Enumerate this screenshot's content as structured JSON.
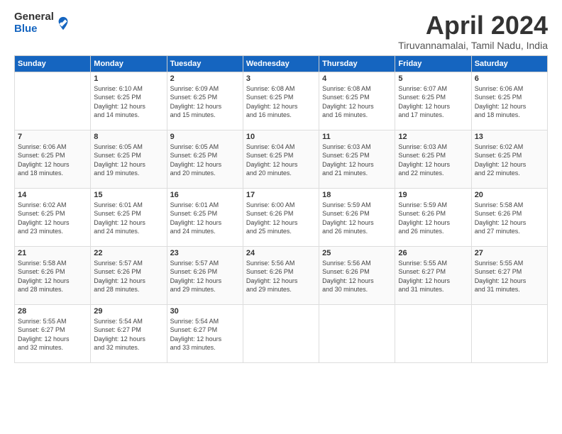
{
  "logo": {
    "general": "General",
    "blue": "Blue"
  },
  "title": "April 2024",
  "subtitle": "Tiruvannamalai, Tamil Nadu, India",
  "days_header": [
    "Sunday",
    "Monday",
    "Tuesday",
    "Wednesday",
    "Thursday",
    "Friday",
    "Saturday"
  ],
  "weeks": [
    [
      {
        "num": "",
        "info": ""
      },
      {
        "num": "1",
        "info": "Sunrise: 6:10 AM\nSunset: 6:25 PM\nDaylight: 12 hours\nand 14 minutes."
      },
      {
        "num": "2",
        "info": "Sunrise: 6:09 AM\nSunset: 6:25 PM\nDaylight: 12 hours\nand 15 minutes."
      },
      {
        "num": "3",
        "info": "Sunrise: 6:08 AM\nSunset: 6:25 PM\nDaylight: 12 hours\nand 16 minutes."
      },
      {
        "num": "4",
        "info": "Sunrise: 6:08 AM\nSunset: 6:25 PM\nDaylight: 12 hours\nand 16 minutes."
      },
      {
        "num": "5",
        "info": "Sunrise: 6:07 AM\nSunset: 6:25 PM\nDaylight: 12 hours\nand 17 minutes."
      },
      {
        "num": "6",
        "info": "Sunrise: 6:06 AM\nSunset: 6:25 PM\nDaylight: 12 hours\nand 18 minutes."
      }
    ],
    [
      {
        "num": "7",
        "info": "Sunrise: 6:06 AM\nSunset: 6:25 PM\nDaylight: 12 hours\nand 18 minutes."
      },
      {
        "num": "8",
        "info": "Sunrise: 6:05 AM\nSunset: 6:25 PM\nDaylight: 12 hours\nand 19 minutes."
      },
      {
        "num": "9",
        "info": "Sunrise: 6:05 AM\nSunset: 6:25 PM\nDaylight: 12 hours\nand 20 minutes."
      },
      {
        "num": "10",
        "info": "Sunrise: 6:04 AM\nSunset: 6:25 PM\nDaylight: 12 hours\nand 20 minutes."
      },
      {
        "num": "11",
        "info": "Sunrise: 6:03 AM\nSunset: 6:25 PM\nDaylight: 12 hours\nand 21 minutes."
      },
      {
        "num": "12",
        "info": "Sunrise: 6:03 AM\nSunset: 6:25 PM\nDaylight: 12 hours\nand 22 minutes."
      },
      {
        "num": "13",
        "info": "Sunrise: 6:02 AM\nSunset: 6:25 PM\nDaylight: 12 hours\nand 22 minutes."
      }
    ],
    [
      {
        "num": "14",
        "info": "Sunrise: 6:02 AM\nSunset: 6:25 PM\nDaylight: 12 hours\nand 23 minutes."
      },
      {
        "num": "15",
        "info": "Sunrise: 6:01 AM\nSunset: 6:25 PM\nDaylight: 12 hours\nand 24 minutes."
      },
      {
        "num": "16",
        "info": "Sunrise: 6:01 AM\nSunset: 6:25 PM\nDaylight: 12 hours\nand 24 minutes."
      },
      {
        "num": "17",
        "info": "Sunrise: 6:00 AM\nSunset: 6:26 PM\nDaylight: 12 hours\nand 25 minutes."
      },
      {
        "num": "18",
        "info": "Sunrise: 5:59 AM\nSunset: 6:26 PM\nDaylight: 12 hours\nand 26 minutes."
      },
      {
        "num": "19",
        "info": "Sunrise: 5:59 AM\nSunset: 6:26 PM\nDaylight: 12 hours\nand 26 minutes."
      },
      {
        "num": "20",
        "info": "Sunrise: 5:58 AM\nSunset: 6:26 PM\nDaylight: 12 hours\nand 27 minutes."
      }
    ],
    [
      {
        "num": "21",
        "info": "Sunrise: 5:58 AM\nSunset: 6:26 PM\nDaylight: 12 hours\nand 28 minutes."
      },
      {
        "num": "22",
        "info": "Sunrise: 5:57 AM\nSunset: 6:26 PM\nDaylight: 12 hours\nand 28 minutes."
      },
      {
        "num": "23",
        "info": "Sunrise: 5:57 AM\nSunset: 6:26 PM\nDaylight: 12 hours\nand 29 minutes."
      },
      {
        "num": "24",
        "info": "Sunrise: 5:56 AM\nSunset: 6:26 PM\nDaylight: 12 hours\nand 29 minutes."
      },
      {
        "num": "25",
        "info": "Sunrise: 5:56 AM\nSunset: 6:26 PM\nDaylight: 12 hours\nand 30 minutes."
      },
      {
        "num": "26",
        "info": "Sunrise: 5:55 AM\nSunset: 6:27 PM\nDaylight: 12 hours\nand 31 minutes."
      },
      {
        "num": "27",
        "info": "Sunrise: 5:55 AM\nSunset: 6:27 PM\nDaylight: 12 hours\nand 31 minutes."
      }
    ],
    [
      {
        "num": "28",
        "info": "Sunrise: 5:55 AM\nSunset: 6:27 PM\nDaylight: 12 hours\nand 32 minutes."
      },
      {
        "num": "29",
        "info": "Sunrise: 5:54 AM\nSunset: 6:27 PM\nDaylight: 12 hours\nand 32 minutes."
      },
      {
        "num": "30",
        "info": "Sunrise: 5:54 AM\nSunset: 6:27 PM\nDaylight: 12 hours\nand 33 minutes."
      },
      {
        "num": "",
        "info": ""
      },
      {
        "num": "",
        "info": ""
      },
      {
        "num": "",
        "info": ""
      },
      {
        "num": "",
        "info": ""
      }
    ]
  ]
}
